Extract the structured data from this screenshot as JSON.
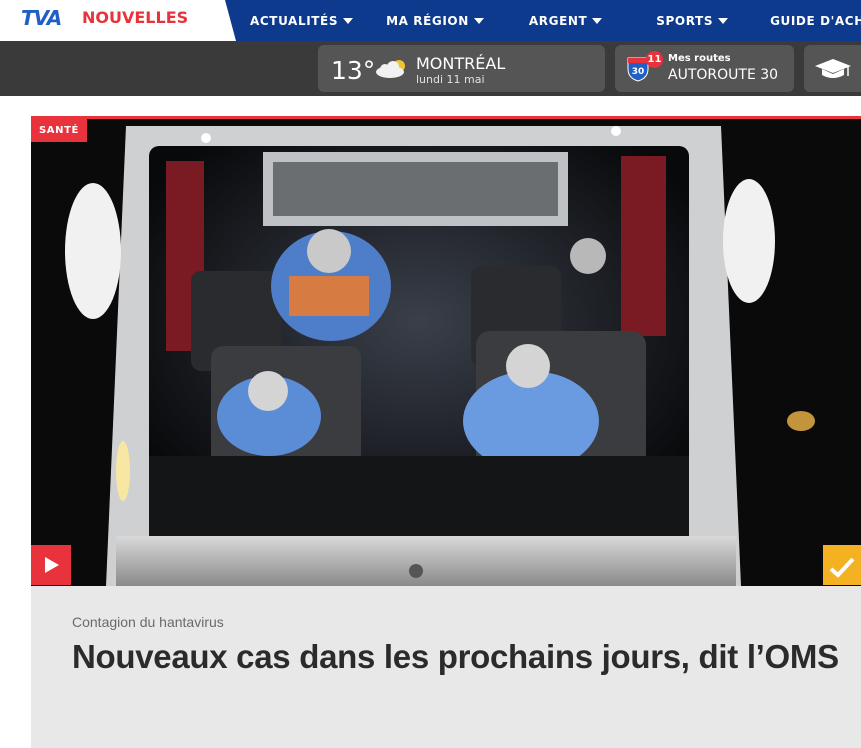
{
  "header": {
    "logo_tva": "TVA",
    "logo_brand": "NOUVELLES",
    "nav": [
      {
        "label": "ACTUALITÉS",
        "dropdown": true
      },
      {
        "label": "MA RÉGION",
        "dropdown": true
      },
      {
        "label": "ARGENT",
        "dropdown": true
      },
      {
        "label": "SPORTS",
        "dropdown": true
      },
      {
        "label": "GUIDE D'ACHAT",
        "dropdown": false
      }
    ]
  },
  "infobar": {
    "weather": {
      "temp": "13°",
      "city": "MONTRÉAL",
      "date": "lundi 11 mai",
      "icon": "partly-cloudy-icon"
    },
    "routes": {
      "title": "Mes routes",
      "route": "AUTOROUTE 30",
      "count": "11",
      "highway_number": "30",
      "icon": "highway-shield-icon"
    },
    "school": {
      "icon": "graduation-cap-icon"
    }
  },
  "article": {
    "category": "SANTÉ",
    "kicker": "Contagion du hantavirus",
    "headline": "Nouveaux cas dans les prochains jours, dit l’OMS",
    "image_description": "photo",
    "colors": {
      "accent": "#e8323c",
      "live": "#f4b223",
      "nav_bg": "#0d3a8c"
    }
  }
}
